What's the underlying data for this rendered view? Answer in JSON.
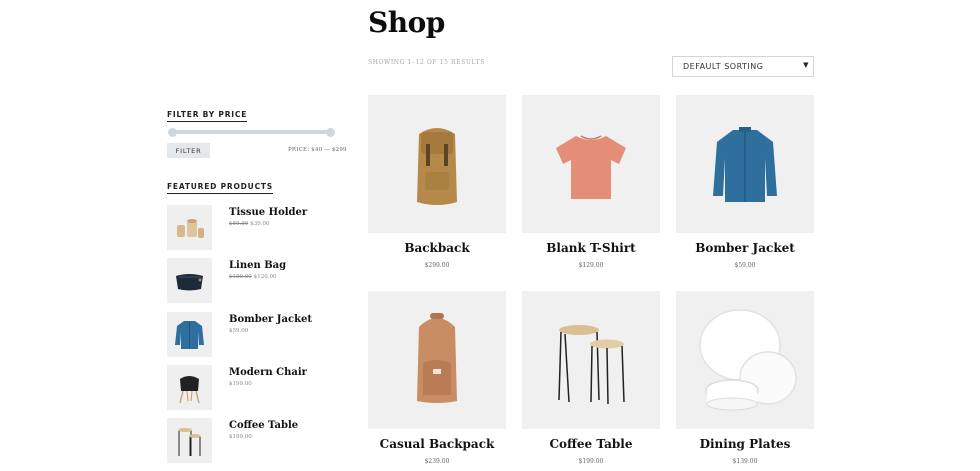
{
  "shop": {
    "title": "Shop",
    "results_text": "SHOWING 1–12 OF 15 RESULTS",
    "sort": {
      "selected": "DEFAULT SORTING",
      "arrow_icon": "caret-down-icon"
    }
  },
  "sidebar": {
    "price_filter": {
      "title": "FILTER BY PRICE",
      "button_label": "FILTER",
      "price_text": "PRICE: $40 — $299",
      "range_min_fraction": 0.0,
      "range_max_fraction": 1.0
    },
    "featured": {
      "title": "FEATURED PRODUCTS",
      "items": [
        {
          "name": "Tissue Holder",
          "old_price": "$50.00",
          "price": "$39.00",
          "icon": "tissue-holder-image"
        },
        {
          "name": "Linen Bag",
          "old_price": "$150.00",
          "price": "$120.00",
          "icon": "linen-bag-image"
        },
        {
          "name": "Bomber Jacket",
          "old_price": "",
          "price": "$59.00",
          "icon": "bomber-jacket-image"
        },
        {
          "name": "Modern Chair",
          "old_price": "",
          "price": "$199.00",
          "icon": "modern-chair-image"
        },
        {
          "name": "Coffee Table",
          "old_price": "",
          "price": "$199.00",
          "icon": "coffee-table-image"
        }
      ]
    }
  },
  "products": [
    {
      "name": "Backback",
      "price": "$299.00",
      "icon": "backpack-image"
    },
    {
      "name": "Blank T-Shirt",
      "price": "$129.00",
      "icon": "t-shirt-image"
    },
    {
      "name": "Bomber Jacket",
      "price": "$59.00",
      "icon": "jacket-image"
    },
    {
      "name": "Casual Backpack",
      "price": "$239.00",
      "icon": "casual-backpack-image"
    },
    {
      "name": "Coffee Table",
      "price": "$199.00",
      "icon": "coffee-table-image"
    },
    {
      "name": "Dining Plates",
      "price": "$139.00",
      "icon": "plates-image"
    }
  ],
  "colors": {
    "accent_jacket": "#2f6f9e",
    "tshirt": "#e48e78",
    "backpack": "#b5894a",
    "casual_backpack": "#c98d63"
  }
}
